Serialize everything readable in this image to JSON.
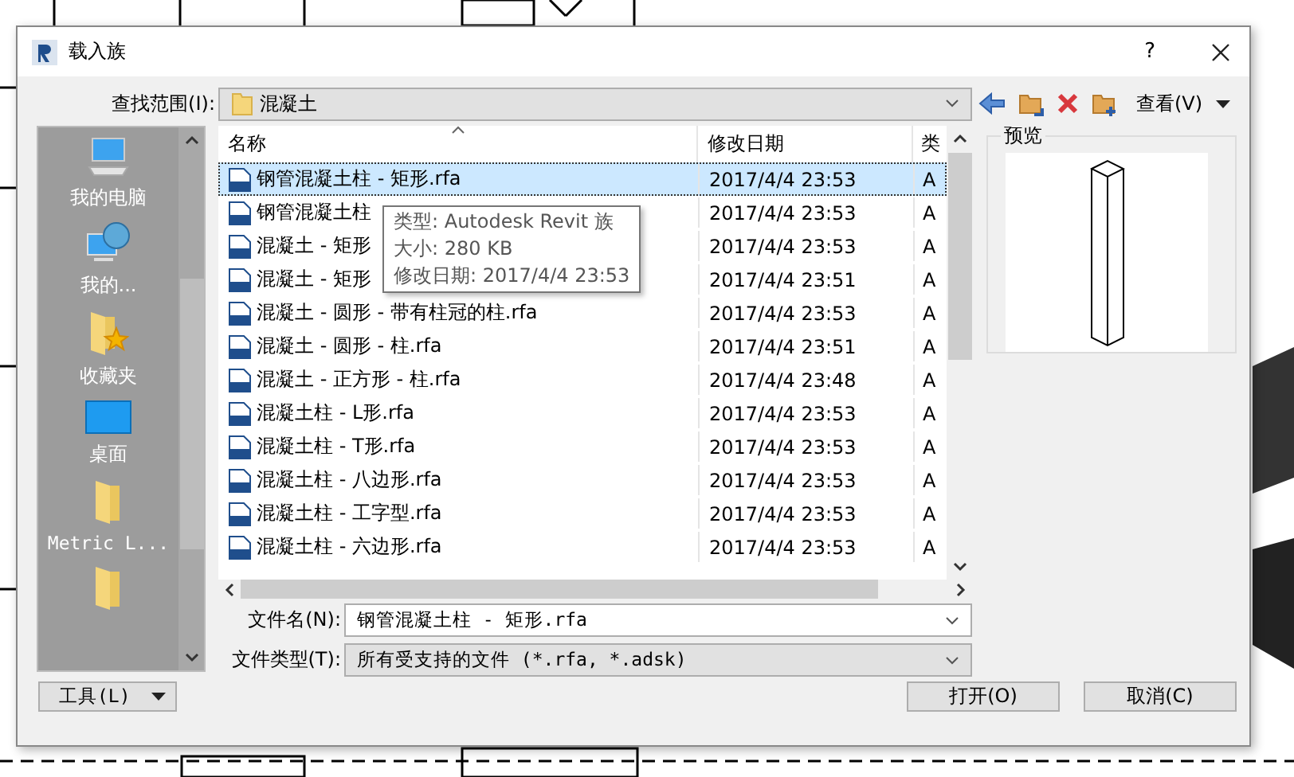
{
  "window": {
    "title": "载入族",
    "help": "?"
  },
  "look_in": {
    "label": "查找范围(I):",
    "value": "混凝土"
  },
  "toolbar": {
    "view_label": "查看(V)"
  },
  "places": [
    {
      "label": "我的电脑",
      "kind": "computer"
    },
    {
      "label": "我的...",
      "kind": "network"
    },
    {
      "label": "收藏夹",
      "kind": "favorites"
    },
    {
      "label": "桌面",
      "kind": "desktop"
    },
    {
      "label": "Metric L...",
      "kind": "folder"
    },
    {
      "kind": "folder"
    }
  ],
  "file_list": {
    "columns": [
      "名称",
      "修改日期",
      "类"
    ],
    "rows": [
      {
        "name": "钢管混凝土柱 - 矩形.rfa",
        "date": "2017/4/4 23:53",
        "type": "A",
        "selected": true
      },
      {
        "name": "钢管混凝土柱",
        "date": "2017/4/4 23:53",
        "type": "A",
        "selected": false
      },
      {
        "name": "混凝土 - 矩形",
        "date": "2017/4/4 23:53",
        "type": "A",
        "selected": false
      },
      {
        "name": "混凝土 - 矩形",
        "date": "2017/4/4 23:51",
        "type": "A",
        "selected": false
      },
      {
        "name": "混凝土 - 圆形 - 带有柱冠的柱.rfa",
        "date": "2017/4/4 23:53",
        "type": "A",
        "selected": false
      },
      {
        "name": "混凝土 - 圆形 - 柱.rfa",
        "date": "2017/4/4 23:51",
        "type": "A",
        "selected": false
      },
      {
        "name": "混凝土 - 正方形 - 柱.rfa",
        "date": "2017/4/4 23:48",
        "type": "A",
        "selected": false
      },
      {
        "name": "混凝土柱 - L形.rfa",
        "date": "2017/4/4 23:53",
        "type": "A",
        "selected": false
      },
      {
        "name": "混凝土柱 - T形.rfa",
        "date": "2017/4/4 23:53",
        "type": "A",
        "selected": false
      },
      {
        "name": "混凝土柱 - 八边形.rfa",
        "date": "2017/4/4 23:53",
        "type": "A",
        "selected": false
      },
      {
        "name": "混凝土柱 - 工字型.rfa",
        "date": "2017/4/4 23:53",
        "type": "A",
        "selected": false
      },
      {
        "name": "混凝土柱 - 六边形.rfa",
        "date": "2017/4/4 23:53",
        "type": "A",
        "selected": false
      }
    ],
    "tooltip": [
      "类型: Autodesk Revit 族",
      "大小: 280 KB",
      "修改日期: 2017/4/4 23:53"
    ]
  },
  "preview": {
    "label": "预览"
  },
  "file_name": {
    "label": "文件名(N):",
    "value": "钢管混凝土柱 - 矩形.rfa"
  },
  "file_type": {
    "label": "文件类型(T):",
    "value": "所有受支持的文件 (*.rfa, *.adsk)"
  },
  "buttons": {
    "tools": "工具(L)",
    "open": "打开(O)",
    "cancel": "取消(C)"
  }
}
